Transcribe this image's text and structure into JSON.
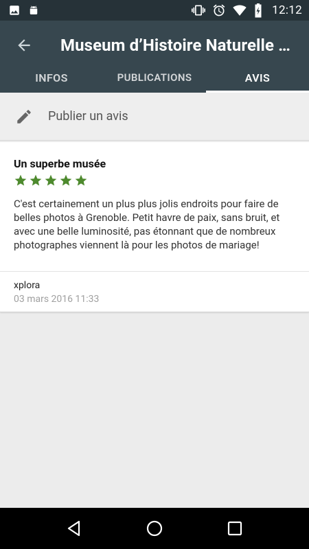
{
  "status_bar": {
    "time": "12:12",
    "icons": [
      "image-icon",
      "android-icon",
      "vibrate-icon",
      "alarm-icon",
      "wifi-icon",
      "battery-charging-icon"
    ]
  },
  "toolbar": {
    "title": "Museum d’Histoire Naturelle de Grenoble",
    "back_icon": "arrow-back-icon"
  },
  "tabs": [
    {
      "label": "INFOS",
      "active": false
    },
    {
      "label": "PUBLICATIONS",
      "active": false
    },
    {
      "label": "AVIS",
      "active": true
    }
  ],
  "publish": {
    "label": "Publier un avis",
    "icon": "pencil-icon"
  },
  "review": {
    "title": "Un superbe musée",
    "rating": 5,
    "rating_max": 5,
    "star_color": "#4e8a2e",
    "text": "C'est certainement un plus plus jolis endroits pour faire de belles photos à Grenoble. Petit havre de paix, sans bruit, et avec une belle luminosité, pas étonnant que de nombreux photographes viennent là pour les photos de mariage!",
    "author": "xplora",
    "date": "03 mars 2016 11:33"
  },
  "nav": {
    "back": "nav-back-icon",
    "home": "nav-home-icon",
    "recents": "nav-recents-icon"
  },
  "colors": {
    "status_bar": "#263238",
    "app_bar": "#37474f",
    "background": "#ececec"
  }
}
